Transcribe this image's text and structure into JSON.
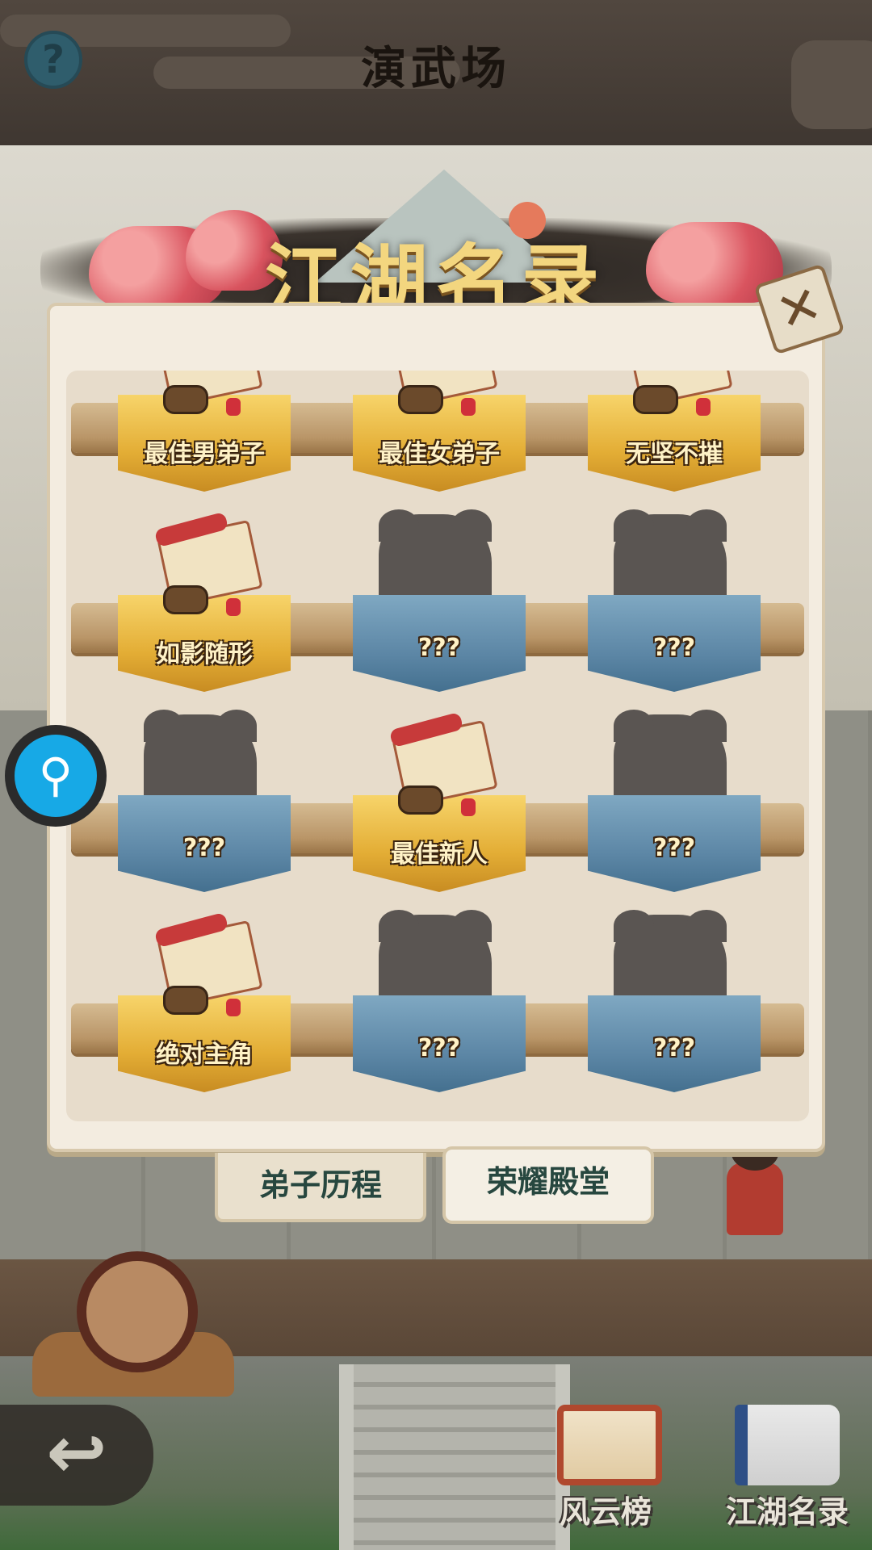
{
  "top_bar": {
    "help_symbol": "?",
    "title": "演武场"
  },
  "panel": {
    "title": "江湖名录",
    "close_symbol": "✕",
    "rows": [
      {
        "slots": [
          {
            "label": "最佳男弟子",
            "unlocked": true
          },
          {
            "label": "最佳女弟子",
            "unlocked": true
          },
          {
            "label": "无坚不摧",
            "unlocked": true
          }
        ]
      },
      {
        "slots": [
          {
            "label": "如影随形",
            "unlocked": true
          },
          {
            "label": "???",
            "unlocked": false
          },
          {
            "label": "???",
            "unlocked": false
          }
        ]
      },
      {
        "slots": [
          {
            "label": "???",
            "unlocked": false
          },
          {
            "label": "最佳新人",
            "unlocked": true
          },
          {
            "label": "???",
            "unlocked": false
          }
        ]
      },
      {
        "slots": [
          {
            "label": "绝对主角",
            "unlocked": true
          },
          {
            "label": "???",
            "unlocked": false
          },
          {
            "label": "???",
            "unlocked": false
          }
        ]
      }
    ]
  },
  "tabs": [
    {
      "label": "弟子历程",
      "active": false
    },
    {
      "label": "荣耀殿堂",
      "active": true
    }
  ],
  "bottom_nav": {
    "back_symbol": "↩",
    "items": [
      {
        "label": "风云榜",
        "icon": "scroll-board-icon"
      },
      {
        "label": "江湖名录",
        "icon": "book-icon"
      }
    ]
  },
  "colors": {
    "gold_banner": "#e3ad35",
    "blue_banner": "#5d87a6",
    "search_button": "#17a9e6",
    "title_gold": "#f3d67f"
  }
}
